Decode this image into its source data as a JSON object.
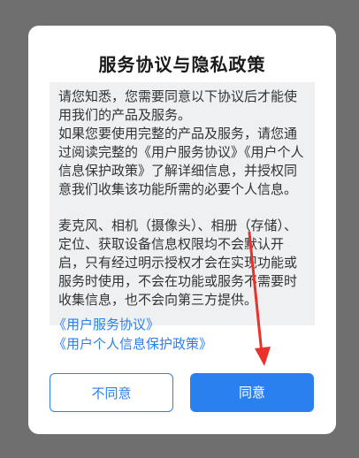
{
  "dialog": {
    "title": "服务协议与隐私政策",
    "paragraphs": [
      "请您知悉，您需要同意以下协议后才能使用我们的产品及服务。",
      "如果您要使用完整的产品及服务，请您通过阅读完整的《用户服务协议》《用户个人信息保护政策》了解详细信息，并授权同意我们收集该功能所需的必要个人信息。",
      "麦克风、相机（摄像头）、相册（存储）、定位、获取设备信息权限均不会默认开启，只有经过明示授权才会在实现功能或服务时使用，不会在功能或服务不需要时收集信息，也不会向第三方提供。"
    ],
    "links": {
      "service_agreement": "《用户服务协议》",
      "privacy_policy": "《用户个人信息保护政策》"
    },
    "buttons": {
      "decline": "不同意",
      "agree": "同意"
    }
  },
  "colors": {
    "accent": "#2b80f0",
    "annotation_arrow": "#e8322a",
    "overlay": "#6f6f6f"
  }
}
